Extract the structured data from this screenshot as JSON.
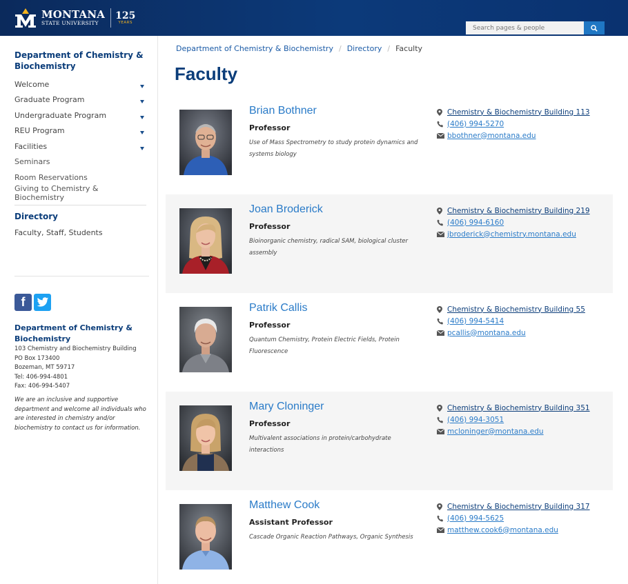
{
  "header": {
    "logo_name": "MONTANA",
    "logo_sub": "STATE UNIVERSITY",
    "logo_anniv": "125",
    "logo_anniv_sub": "YEARS",
    "search_placeholder": "Search pages & people",
    "search_icon": "search-icon"
  },
  "colors": {
    "brand_navy": "#0b3d7a",
    "link_blue": "#2a7bc8",
    "accent_gold": "#f5b41e",
    "shaded_row": "#f5f5f5"
  },
  "sidebar": {
    "title": "Department of Chemistry & Biochemistry",
    "items": [
      {
        "label": "Welcome",
        "has_submenu": true
      },
      {
        "label": "Graduate Program",
        "has_submenu": true
      },
      {
        "label": "Undergraduate Program",
        "has_submenu": true
      },
      {
        "label": "REU Program",
        "has_submenu": true
      },
      {
        "label": "Facilities",
        "has_submenu": true
      },
      {
        "label": "Seminars",
        "has_submenu": false
      },
      {
        "label": "Room Reservations",
        "has_submenu": false
      },
      {
        "label": "Giving to Chemistry & Biochemistry",
        "has_submenu": false
      }
    ],
    "directory_heading": "Directory",
    "directory_link": "Faculty, Staff, Students",
    "social": {
      "facebook": "f",
      "twitter": "t"
    },
    "contact": {
      "name": "Department of Chemistry & Biochemistry",
      "building": "103 Chemistry and Biochemistry Building",
      "po_box": "PO Box 173400",
      "city": "Bozeman, MT 59717",
      "tel": "Tel: 406-994-4801",
      "fax": "Fax: 406-994-5407",
      "note": "We are an inclusive and supportive department and welcome all individuals who are interested in chemistry and/or biochemistry to contact us for information."
    }
  },
  "breadcrumb": {
    "items": [
      "Department of Chemistry & Biochemistry",
      "Directory"
    ],
    "current": "Faculty"
  },
  "page_title": "Faculty",
  "faculty": [
    {
      "name": "Brian Bothner",
      "title": "Professor",
      "research": "Use of Mass Spectrometry to study protein dynamics and systems biology",
      "office": "Chemistry & Biochemistry Building 113",
      "phone": "(406) 994-5270",
      "email": "bbothner@montana.edu"
    },
    {
      "name": "Joan Broderick",
      "title": "Professor",
      "research": "Bioinorganic chemistry, radical SAM, biological cluster assembly",
      "office": "Chemistry & Biochemistry Building 219",
      "phone": "(406) 994-6160",
      "email": "jbroderick@chemistry.montana.edu"
    },
    {
      "name": "Patrik Callis",
      "title": "Professor",
      "research": "Quantum Chemistry, Protein Electric Fields, Protein Fluorescence",
      "office": "Chemistry & Biochemistry Building 55",
      "phone": "(406) 994-5414",
      "email": "pcallis@montana.edu"
    },
    {
      "name": "Mary Cloninger",
      "title": "Professor",
      "research": "Multivalent associations in protein/carbohydrate interactions",
      "office": "Chemistry & Biochemistry Building 351",
      "phone": "(406) 994-3051",
      "email": "mcloninger@montana.edu"
    },
    {
      "name": "Matthew Cook",
      "title": "Assistant Professor",
      "research": "Cascade Organic Reaction Pathways, Organic Synthesis",
      "office": "Chemistry & Biochemistry Building 317",
      "phone": "(406) 994-5625",
      "email": "matthew.cook6@montana.edu"
    }
  ]
}
